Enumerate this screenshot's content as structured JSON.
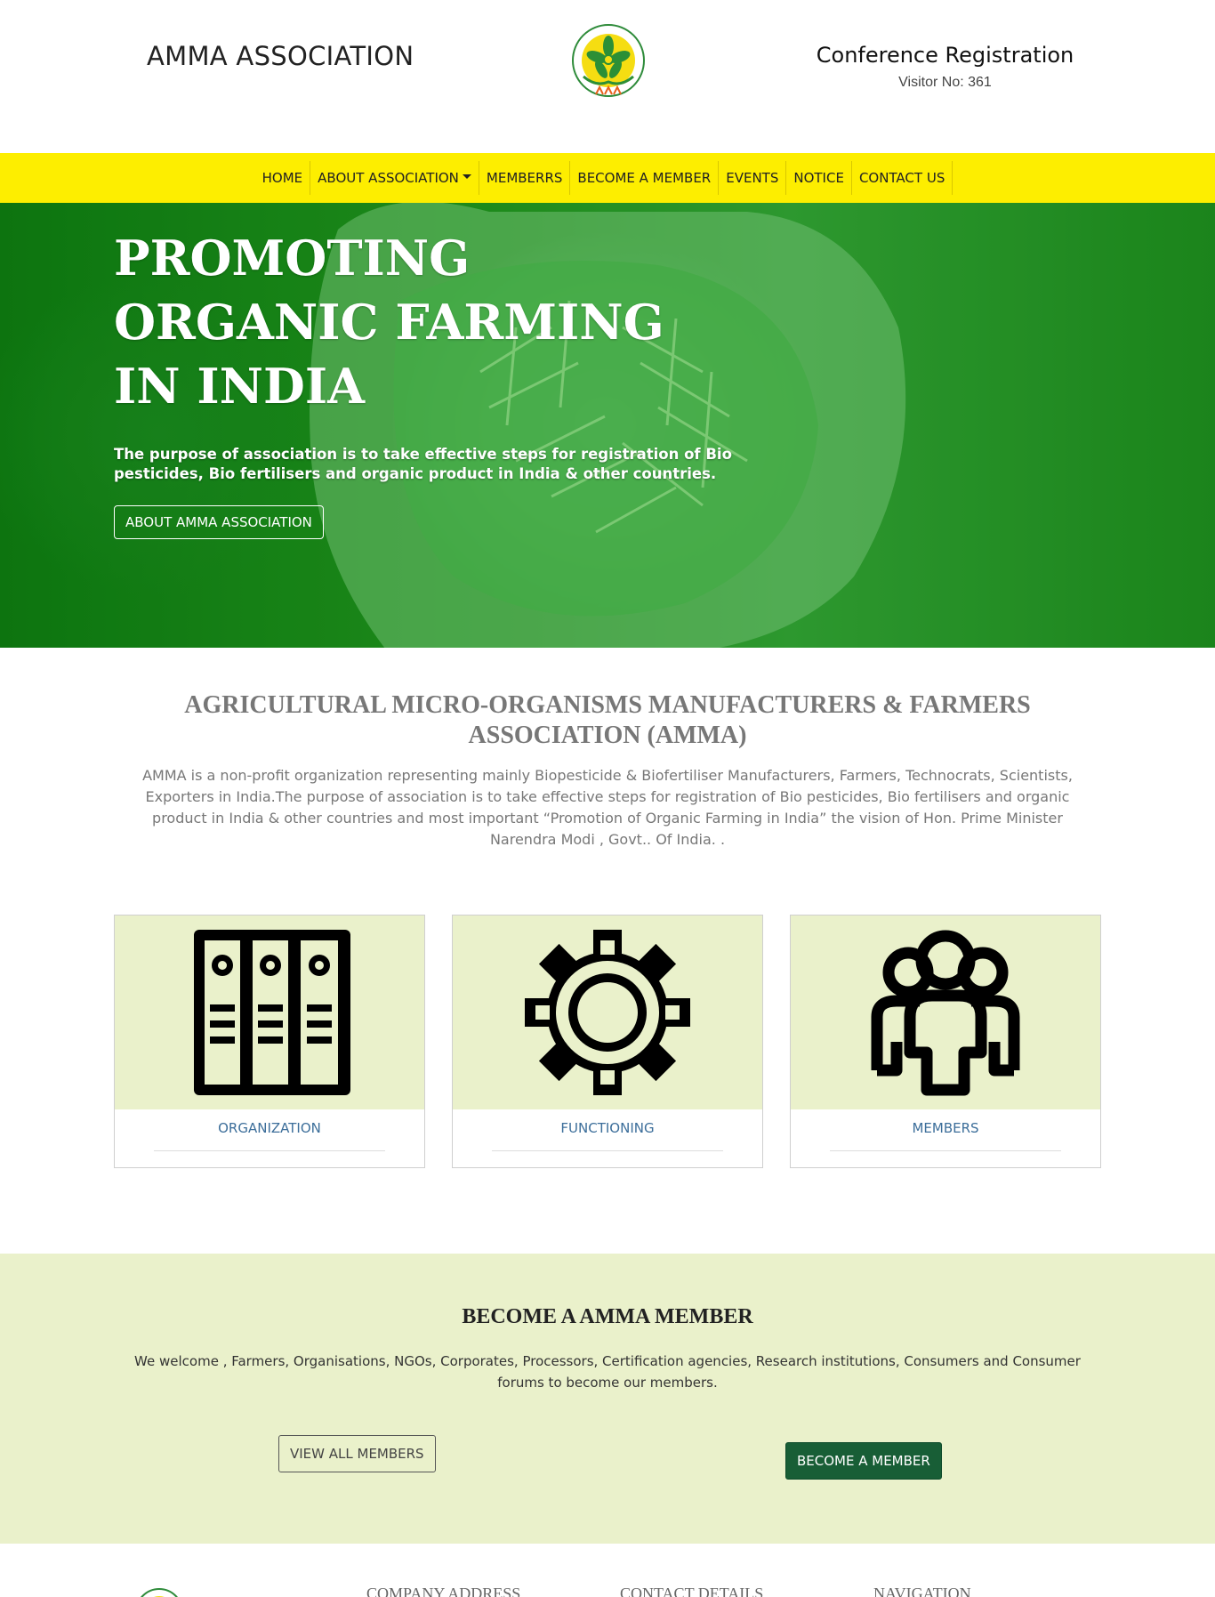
{
  "header": {
    "site_title": "AMMA ASSOCIATION",
    "logo_text": "AMMA",
    "registration_link": "Conference Registration",
    "visitor_counter": "Visitor No: 361"
  },
  "nav": {
    "items": [
      {
        "label": "HOME"
      },
      {
        "label": "ABOUT ASSOCIATION"
      },
      {
        "label": "MEMBERRS"
      },
      {
        "label": "BECOME A MEMBER"
      },
      {
        "label": "EVENTS"
      },
      {
        "label": "NOTICE"
      },
      {
        "label": "CONTACT US"
      }
    ]
  },
  "hero": {
    "title_lines": [
      "PROMOTING",
      "ORGANIC FARMING",
      "IN INDIA"
    ],
    "subtitle": "The purpose of association is to take effective steps for registration of Bio pesticides, Bio fertilisers and organic product in India & other countries.",
    "button_label": "ABOUT AMMA ASSOCIATION"
  },
  "about": {
    "heading": "AGRICULTURAL MICRO-ORGANISMS MANUFACTURERS & FARMERS ASSOCIATION (AMMA)",
    "text": "AMMA is a non-profit organization representing mainly Biopesticide & Biofertiliser Manufacturers, Farmers, Technocrats, Scientists, Exporters in India.The purpose of association is to take effective steps for registration of Bio pesticides, Bio fertilisers and organic product in India & other countries and most important “Promotion of Organic Farming in India” the vision of Hon. Prime Minister Narendra Modi , Govt.. Of India. ."
  },
  "cards": [
    {
      "label": "ORGANIZATION",
      "icon": "filing-cabinet-icon"
    },
    {
      "label": "FUNCTIONING",
      "icon": "gear-icon"
    },
    {
      "label": "MEMBERS",
      "icon": "people-group-icon"
    }
  ],
  "member_section": {
    "title": "BECOME A AMMA MEMBER",
    "text": "We welcome , Farmers, Organisations, NGOs, Corporates, Processors, Certification agencies, Research institutions, Consumers and Consumer forums to become our members.",
    "view_all_label": "VIEW ALL MEMBERS",
    "become_member_label": "BECOME A MEMBER"
  },
  "footer": {
    "columns": [
      "COMPANY ADDRESS",
      "CONTACT DETAILS",
      "NAVIGATION"
    ]
  },
  "colors": {
    "nav_background": "#fdee00",
    "hero_green": "#22961f",
    "card_background": "#eaf1cb",
    "card_label": "#3c6e9a",
    "member_background": "#eaf1cb",
    "primary_button": "#185e36"
  }
}
